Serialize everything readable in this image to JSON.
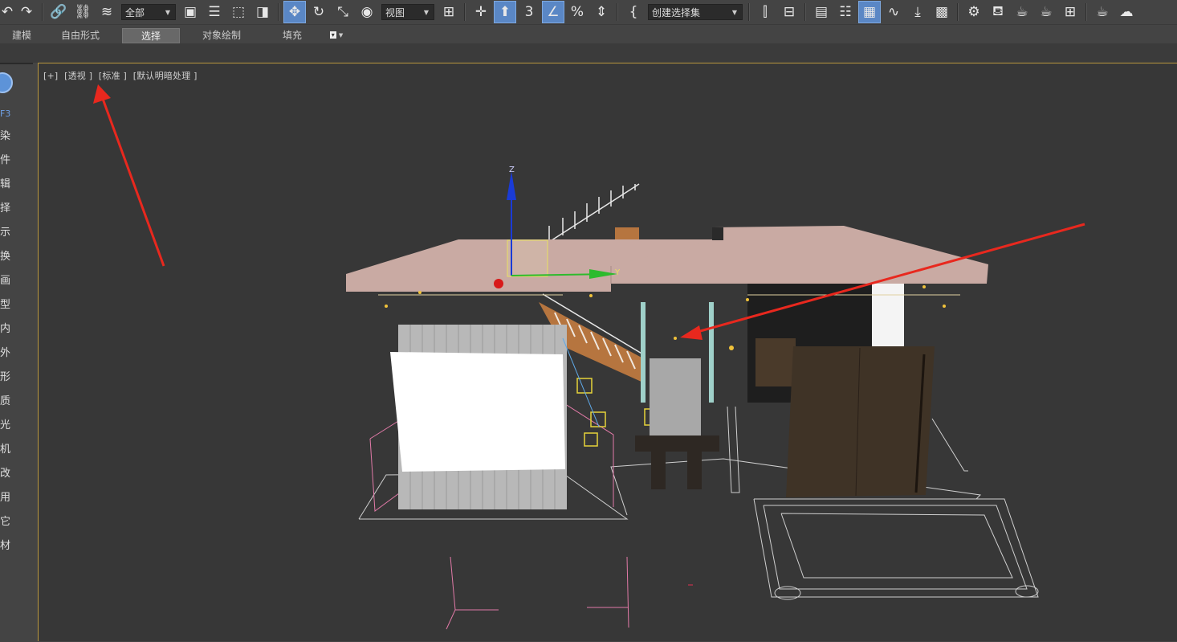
{
  "toolbar": {
    "filter_dropdown": "全部",
    "coord_dropdown": "视图",
    "selection_set_dropdown": "创建选择集",
    "snap_angle_label": "3",
    "percent_snap_label": "%"
  },
  "ribbon": {
    "tabs": [
      {
        "label": "建模"
      },
      {
        "label": "自由形式"
      },
      {
        "label": "选择"
      },
      {
        "label": "对象绘制"
      },
      {
        "label": "填充"
      }
    ],
    "active_tab": "选择"
  },
  "command_panel": {
    "shortcut": "F3",
    "items": [
      "染",
      "件",
      "辑",
      "择",
      "示",
      "换",
      "画",
      "型",
      "内",
      "外",
      "形",
      "质",
      "光",
      "机",
      "改",
      "用",
      "它",
      "材"
    ]
  },
  "viewport": {
    "labels": [
      "[+]",
      "[透视 ]",
      "[标准 ]",
      "[默认明暗处理 ]"
    ],
    "axis_z": "Z",
    "axis_y": "Y"
  },
  "colors": {
    "accent": "#5a87c5",
    "viewport_border": "#b8963e",
    "annotation_arrow": "#e8281e",
    "ceiling": "#c9aaa3",
    "wardrobe": "#3f3326"
  }
}
